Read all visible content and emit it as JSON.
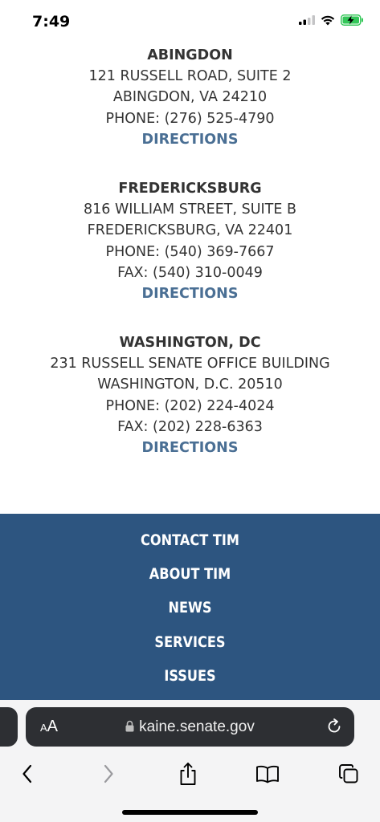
{
  "status": {
    "time": "7:49"
  },
  "offices": [
    {
      "name": "ABINGDON",
      "lines": [
        "121 RUSSELL ROAD, SUITE 2",
        "ABINGDON, VA 24210",
        "PHONE: (276) 525-4790"
      ],
      "directions": "DIRECTIONS"
    },
    {
      "name": "FREDERICKSBURG",
      "lines": [
        "816 WILLIAM STREET, SUITE B",
        "FREDERICKSBURG, VA 22401",
        "PHONE: (540) 369-7667",
        "FAX: (540) 310-0049"
      ],
      "directions": "DIRECTIONS"
    },
    {
      "name": "WASHINGTON, DC",
      "lines": [
        "231 RUSSELL SENATE OFFICE BUILDING",
        "WASHINGTON, D.C. 20510",
        "PHONE: (202) 224-4024",
        "FAX: (202) 228-6363"
      ],
      "directions": "DIRECTIONS"
    }
  ],
  "footer_nav": [
    "CONTACT TIM",
    "ABOUT TIM",
    "NEWS",
    "SERVICES",
    "ISSUES"
  ],
  "browser": {
    "text_size_label_small": "A",
    "text_size_label_large": "A",
    "url": "kaine.senate.gov"
  },
  "colors": {
    "footer_bg": "#2d5580",
    "link": "#4a6f94",
    "battery": "#34c759"
  },
  "icons": [
    "signal-icon",
    "wifi-icon",
    "battery-charging-icon",
    "lock-icon",
    "reload-icon",
    "back-icon",
    "forward-icon",
    "share-icon",
    "bookmarks-icon",
    "tabs-icon"
  ]
}
